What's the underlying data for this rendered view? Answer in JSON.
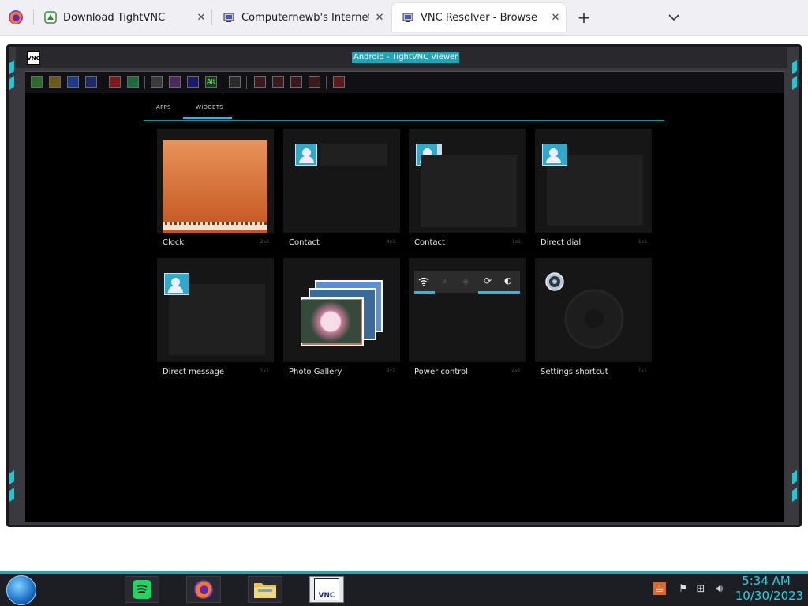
{
  "browser": {
    "tabs": [
      {
        "title": "Download TightVNC",
        "close": "✕",
        "active": false
      },
      {
        "title": "Computernewb's Internet Pub",
        "close": "✕",
        "active": false
      },
      {
        "title": "VNC Resolver - Browse",
        "close": "✕",
        "active": true
      }
    ],
    "new_tab_glyph": "+",
    "tab_menu_glyph": "⌄"
  },
  "vnc": {
    "window_title": "Android - TightVNC Viewer",
    "sys_icon_text": "VNC",
    "toolbar_alt_label": "Alt"
  },
  "android": {
    "tabs": {
      "apps": "APPS",
      "widgets": "WIDGETS"
    },
    "widgets": [
      {
        "name": "Clock",
        "size": "2x2"
      },
      {
        "name": "Contact",
        "size": "4x1"
      },
      {
        "name": "Contact",
        "size": "1x1"
      },
      {
        "name": "Direct dial",
        "size": "1x1"
      },
      {
        "name": "Direct message",
        "size": "1x1"
      },
      {
        "name": "Photo Gallery",
        "size": "2x2"
      },
      {
        "name": "Power control",
        "size": "4x1"
      },
      {
        "name": "Settings shortcut",
        "size": "1x1"
      }
    ]
  },
  "taskbar": {
    "time": "5:34 AM",
    "date": "10/30/2023",
    "vnc_label": "VNC"
  },
  "colors": {
    "accent": "#33b5e5",
    "taskbar_accent": "#1ba9bb",
    "clock_orange": "#d9692a"
  }
}
